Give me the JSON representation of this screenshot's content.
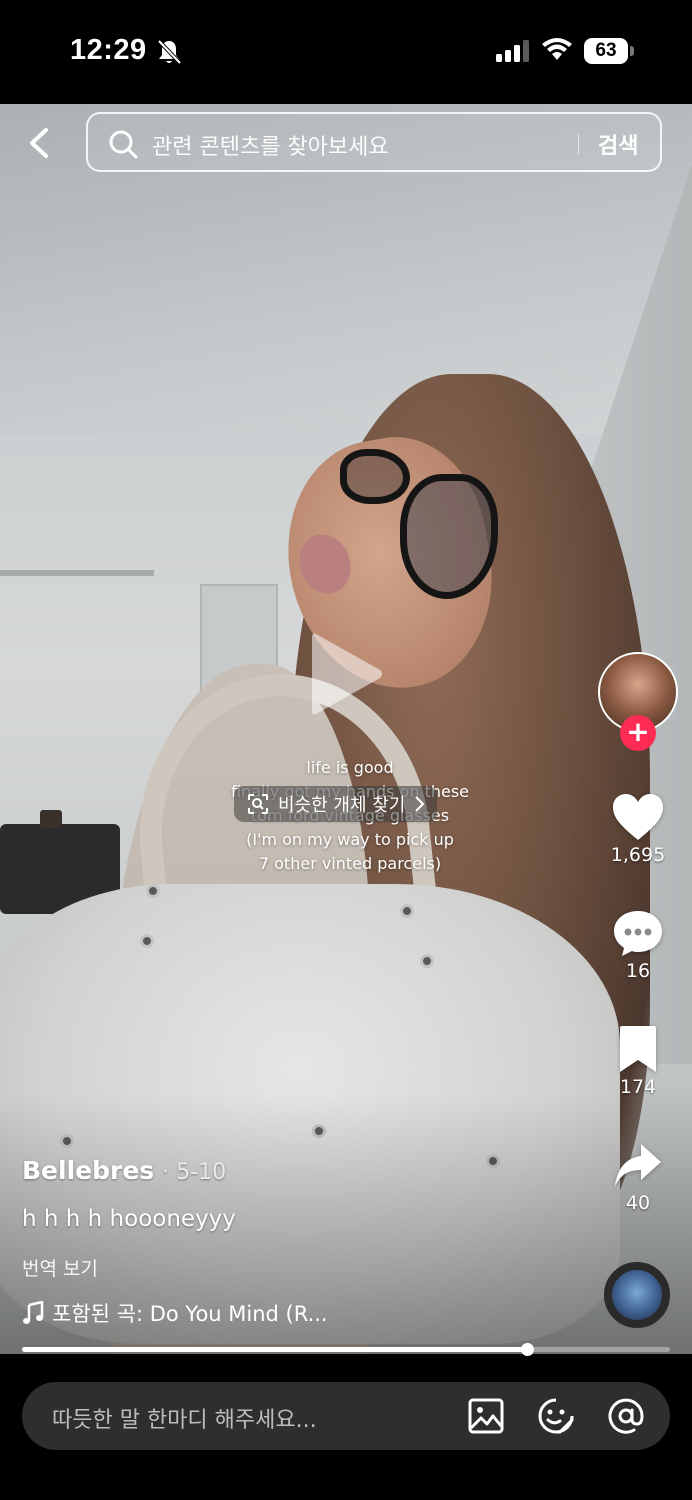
{
  "status_bar": {
    "time": "12:29",
    "battery": "63",
    "icons": [
      "bell-off-icon",
      "signal-icon",
      "wifi-icon",
      "battery-icon"
    ]
  },
  "search": {
    "placeholder": "관련 콘텐츠를 찾아보세요",
    "submit_label": "검색"
  },
  "video": {
    "caption_lines": [
      "life is good",
      "finally got my hands on these",
      "tom ford vintage glasses",
      "(I'm on my way to pick up",
      "7 other vinted parcels)"
    ],
    "find_similar_label": "비슷한 개체 찾기",
    "progress_fraction": 0.78
  },
  "rail": {
    "likes": "1,695",
    "comments": "16",
    "saves": "174",
    "shares": "40"
  },
  "post": {
    "author": "Bellebres",
    "date": "· 5-10",
    "caption": "h h h h hoooneyyy",
    "translate_label": "번역 보기",
    "music": "포함된 곡: Do You Mind (R..."
  },
  "comment_bar": {
    "placeholder": "따듯한 말 한마디 해주세요..."
  },
  "colors": {
    "accent": "#fe2c55",
    "background": "#000000"
  }
}
